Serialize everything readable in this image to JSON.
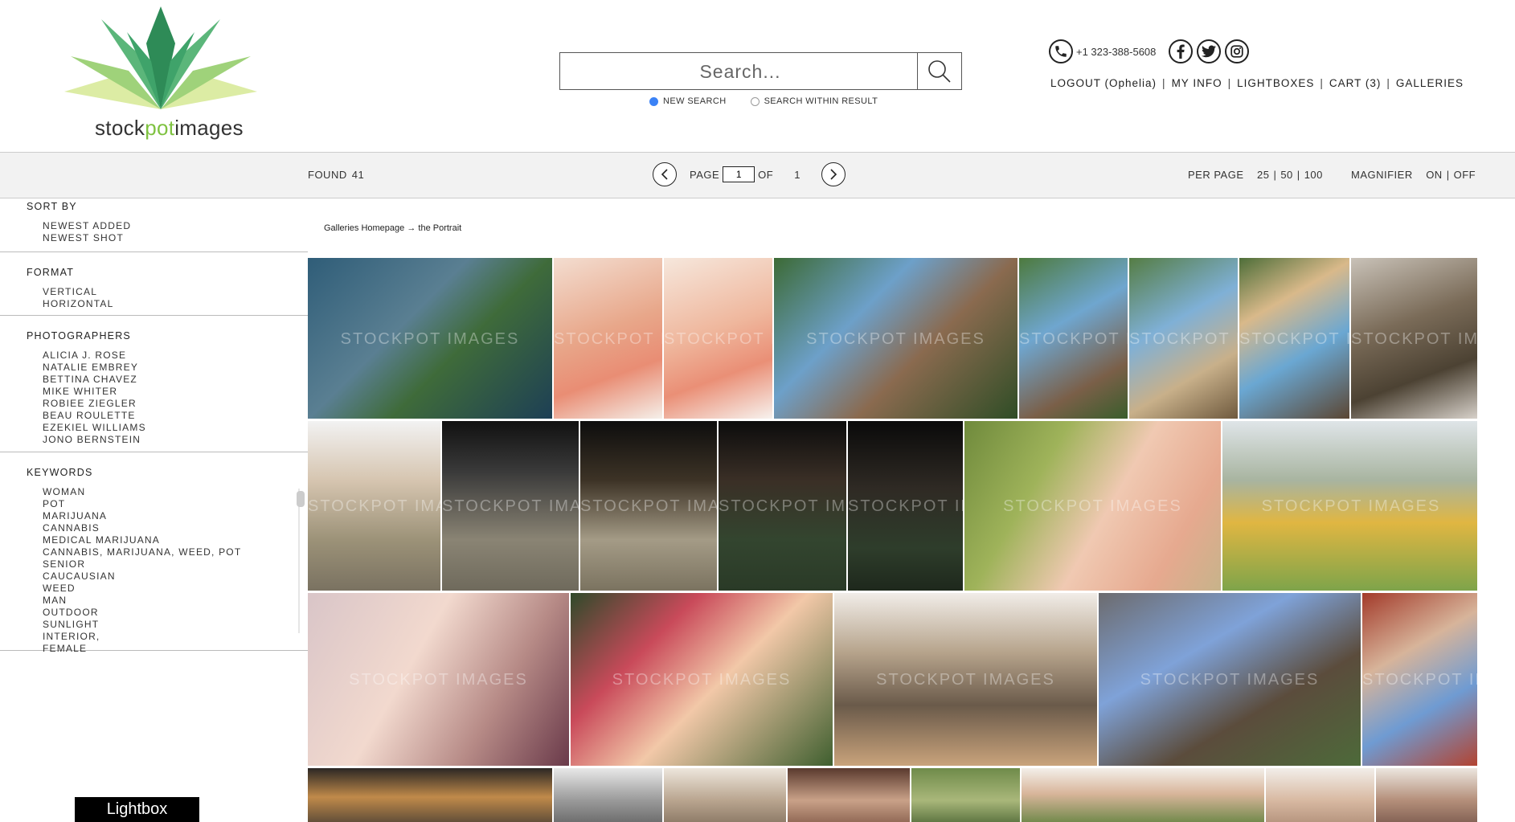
{
  "logo": {
    "text_pre": "stock",
    "text_pot": "pot",
    "text_post": "images"
  },
  "search": {
    "placeholder": "Search...",
    "options": [
      "NEW SEARCH",
      "SEARCH WITHIN RESULT"
    ],
    "selected": "NEW SEARCH"
  },
  "contact": {
    "phone": "+1 323-388-5608"
  },
  "nav": [
    {
      "label": "LOGOUT (Ophelia)"
    },
    {
      "label": "MY INFO"
    },
    {
      "label": "LIGHTBOXES"
    },
    {
      "label": "CART (3)"
    },
    {
      "label": "GALLERIES"
    }
  ],
  "toolbar": {
    "found_label": "FOUND",
    "found_count": "41",
    "page_label": "PAGE",
    "page_value": "1",
    "of_label": "OF",
    "total_pages": "1",
    "per_page_label": "PER PAGE",
    "per_page_options": [
      "25",
      "50",
      "100"
    ],
    "magnifier_label": "MAGNIFIER",
    "magnifier_on": "ON",
    "magnifier_off": "OFF"
  },
  "sidebar": {
    "sort_title": "SORT BY",
    "sort_items": [
      "NEWEST ADDED",
      "NEWEST SHOT"
    ],
    "format_title": "FORMAT",
    "format_items": [
      "VERTICAL",
      "HORIZONTAL"
    ],
    "photographers_title": "PHOTOGRAPHERS",
    "photographers": [
      "ALICIA J. ROSE",
      "NATALIE EMBREY",
      "BETTINA CHAVEZ",
      "MIKE WHITER",
      "ROBIEE ZIEGLER",
      "BEAU ROULETTE",
      "EZEKIEL WILLIAMS",
      "JONO BERNSTEIN"
    ],
    "keywords_title": "KEYWORDS",
    "keywords": [
      "WOMAN",
      "POT",
      "MARIJUANA",
      "CANNABIS",
      "MEDICAL MARIJUANA",
      "CANNABIS, MARIJUANA, WEED, POT",
      "SENIOR",
      "CAUCAUSIAN",
      "WEED",
      "MAN",
      "OUTDOOR",
      "SUNLIGHT",
      "INTERIOR,",
      "FEMALE"
    ]
  },
  "breadcrumb": {
    "home": "Galleries Homepage",
    "arrow": "→",
    "current": "the Portrait"
  },
  "watermark": "STOCKPOT IMAGES",
  "lightbox_label": "Lightbox",
  "colors": {
    "accent_green": "#7fc241",
    "radio_blue": "#3b82f6",
    "toolbar_bg": "#f2f2f2"
  },
  "thumbnails": [
    {
      "name": "man-behind-window-bars-plant",
      "bg": "linear-gradient(135deg,#2f5d78 0%,#5a7f92 40%,#3f6b3a 60%,#1d3f55 100%)"
    },
    {
      "name": "senior-woman-teacup-1",
      "bg": "linear-gradient(160deg,#f3ddd0 0%,#e8a78a 45%,#e98d74 70%,#f5efe9 100%)"
    },
    {
      "name": "senior-woman-teacup-2",
      "bg": "linear-gradient(160deg,#f6e7dc 0%,#efb79d 45%,#ea8f76 70%,#f7f2ee 100%)"
    },
    {
      "name": "senior-woman-gardening-hat",
      "bg": "linear-gradient(135deg,#3c6a35 0%,#6da0c9 35%,#8a6a4f 60%,#2f4d26 100%)"
    },
    {
      "name": "senior-woman-watering-can",
      "bg": "linear-gradient(150deg,#4d7a3e 0%,#6fa6cf 40%,#7a5f48 75%,#3a5e2c 100%)"
    },
    {
      "name": "senior-woman-gloves-plant",
      "bg": "linear-gradient(150deg,#557d44 0%,#7fb0d6 40%,#c8b08a 70%,#6f5a3e 100%)"
    },
    {
      "name": "senior-woman-sunglasses-hat",
      "bg": "linear-gradient(150deg,#4e6e39 0%,#d9b98a 30%,#6aa7d2 60%,#5b4633 100%)"
    },
    {
      "name": "man-covering-face-cap",
      "bg": "linear-gradient(160deg,#c9c2b8 0%,#7a6b58 40%,#4c4233 70%,#d9d3cc 100%)"
    },
    {
      "name": "soldier-man-pills-1",
      "bg": "linear-gradient(180deg,#f2f2f2 0%,#d6c5b0 35%,#9c9278 70%,#7a7261 100%)"
    },
    {
      "name": "soldier-woman-pills",
      "bg": "linear-gradient(180deg,#111 0%,#3a3a3a 30%,#8a8474 70%,#6f6a5c 100%)"
    },
    {
      "name": "soldier-man-pill-bottle",
      "bg": "linear-gradient(180deg,#0d0d0d 0%,#3d3326 35%,#a49b86 70%,#7b7360 100%)"
    },
    {
      "name": "soldier-bearded-cap",
      "bg": "linear-gradient(180deg,#0c0c0c 0%,#3a2f26 35%,#33452f 70%,#2a3a27 100%)"
    },
    {
      "name": "soldier-smoking-pills",
      "bg": "linear-gradient(180deg,#0a0a0a 0%,#2f2a24 40%,#2e3d2b 75%,#1e281c 100%)"
    },
    {
      "name": "woman-smelling-bud",
      "bg": "linear-gradient(120deg,#6f8a3c 0%,#9fb35a 30%,#f0c9b2 55%,#e6a98f 80%,#c7b38a 100%)"
    },
    {
      "name": "woman-kneeling-field",
      "bg": "linear-gradient(180deg,#dfe5e8 0%,#a8b4a0 35%,#e0b642 60%,#7ea44a 100%)"
    },
    {
      "name": "woman-smoking-joint",
      "bg": "linear-gradient(120deg,#d9c5c8 0%,#f2d9ce 40%,#b68a86 70%,#6a3a4a 100%)"
    },
    {
      "name": "woman-drinking-cocktail",
      "bg": "linear-gradient(135deg,#2f4a2a 0%,#c94a5a 30%,#f2c8a8 55%,#3f5f2f 100%)"
    },
    {
      "name": "woman-in-living-room-bong",
      "bg": "linear-gradient(180deg,#f1ede8 0%,#b5a28a 35%,#6a5a4a 65%,#c9a37b 100%)"
    },
    {
      "name": "man-holding-potted-plant",
      "bg": "linear-gradient(150deg,#6c6b6e 0%,#7fa2d8 35%,#5b4c3c 65%,#4d6a3a 100%)"
    },
    {
      "name": "bald-man-plant-gloves",
      "bg": "linear-gradient(150deg,#a33a2a 0%,#d7b49a 35%,#6f9bd2 65%,#b34330 100%)"
    },
    {
      "name": "man-in-workshop",
      "bg": "linear-gradient(180deg,#2b2724 0%,#c08a4a 45%,#3d3732 100%)"
    },
    {
      "name": "woman-at-window-bw",
      "bg": "linear-gradient(180deg,#e8e8e8 0%,#9a9a9a 50%,#5a5a5a 100%)"
    },
    {
      "name": "woman-by-window",
      "bg": "linear-gradient(180deg,#ede6dc 0%,#b9a58f 50%,#7c6a58 100%)"
    },
    {
      "name": "woman-seated-interior",
      "bg": "linear-gradient(180deg,#5a3a2e 0%,#c9a188 50%,#7a5040 100%)"
    },
    {
      "name": "woman-plants-outdoor",
      "bg": "linear-gradient(180deg,#6f8b4a 0%,#a9b77a 50%,#3e5a2a 100%)"
    },
    {
      "name": "woman-with-cannabis-leaf",
      "bg": "linear-gradient(180deg,#f3efe9 0%,#d8b59a 40%,#4e7a30 100%)"
    },
    {
      "name": "senior-woman-portrait",
      "bg": "linear-gradient(180deg,#f2eee9 0%,#d8b9a2 50%,#a88670 100%)"
    },
    {
      "name": "woman-on-couch",
      "bg": "linear-gradient(180deg,#ece6df 0%,#b48f7a 50%,#6f4f45 100%)"
    }
  ]
}
